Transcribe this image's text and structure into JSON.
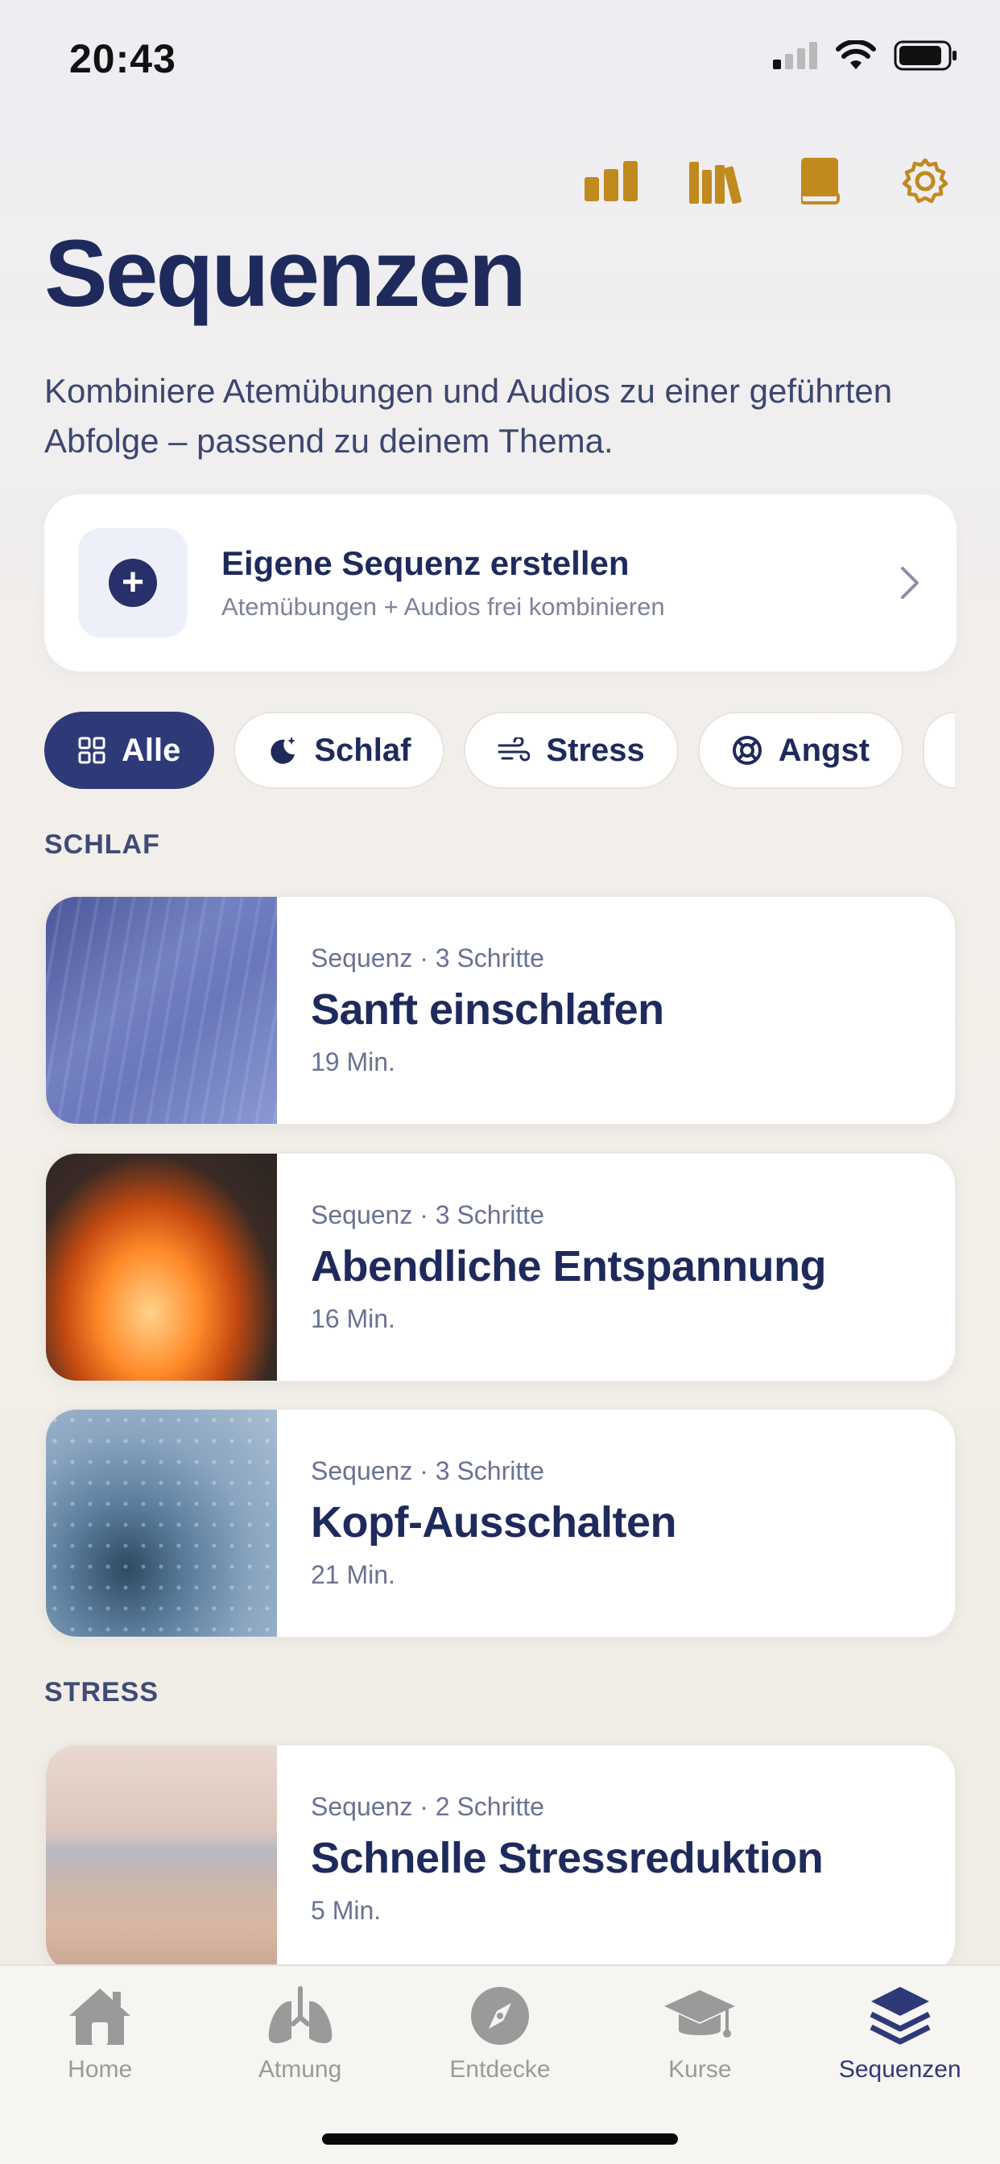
{
  "status_bar": {
    "time": "20:43"
  },
  "header": {
    "title": "Sequenzen",
    "subtitle": "Kombiniere Atemübungen und Audios zu einer geführten Abfolge – passend zu deinem Thema.",
    "action_icons": [
      "stats-icon",
      "library-icon",
      "book-icon",
      "settings-icon"
    ],
    "accent_color": "#c08a1e"
  },
  "create_card": {
    "title": "Eigene Sequenz erstellen",
    "subtitle": "Atemübungen + Audios frei kombinieren"
  },
  "filters": [
    {
      "label": "Alle",
      "icon": "grid-icon",
      "active": true
    },
    {
      "label": "Schlaf",
      "icon": "moon-icon",
      "active": false
    },
    {
      "label": "Stress",
      "icon": "wind-icon",
      "active": false
    },
    {
      "label": "Angst",
      "icon": "lifebuoy-icon",
      "active": false
    }
  ],
  "sections": [
    {
      "label": "SCHLAF",
      "items": [
        {
          "meta": "Sequenz · 3 Schritte",
          "title": "Sanft einschlafen",
          "duration": "19 Min."
        },
        {
          "meta": "Sequenz · 3 Schritte",
          "title": "Abendliche Entspannung",
          "duration": "16 Min."
        },
        {
          "meta": "Sequenz · 3 Schritte",
          "title": "Kopf-Ausschalten",
          "duration": "21 Min."
        }
      ]
    },
    {
      "label": "STRESS",
      "items": [
        {
          "meta": "Sequenz · 2 Schritte",
          "title": "Schnelle Stressreduktion",
          "duration": "5 Min."
        }
      ]
    }
  ],
  "tab_bar": {
    "tabs": [
      {
        "label": "Home",
        "icon": "home-icon"
      },
      {
        "label": "Atmung",
        "icon": "lungs-icon"
      },
      {
        "label": "Entdecke",
        "icon": "compass-icon"
      },
      {
        "label": "Kurse",
        "icon": "graduation-cap-icon"
      },
      {
        "label": "Sequenzen",
        "icon": "layers-icon"
      }
    ],
    "active": "Sequenzen",
    "active_color": "#2e3a78",
    "inactive_color": "#9a9a9a"
  }
}
